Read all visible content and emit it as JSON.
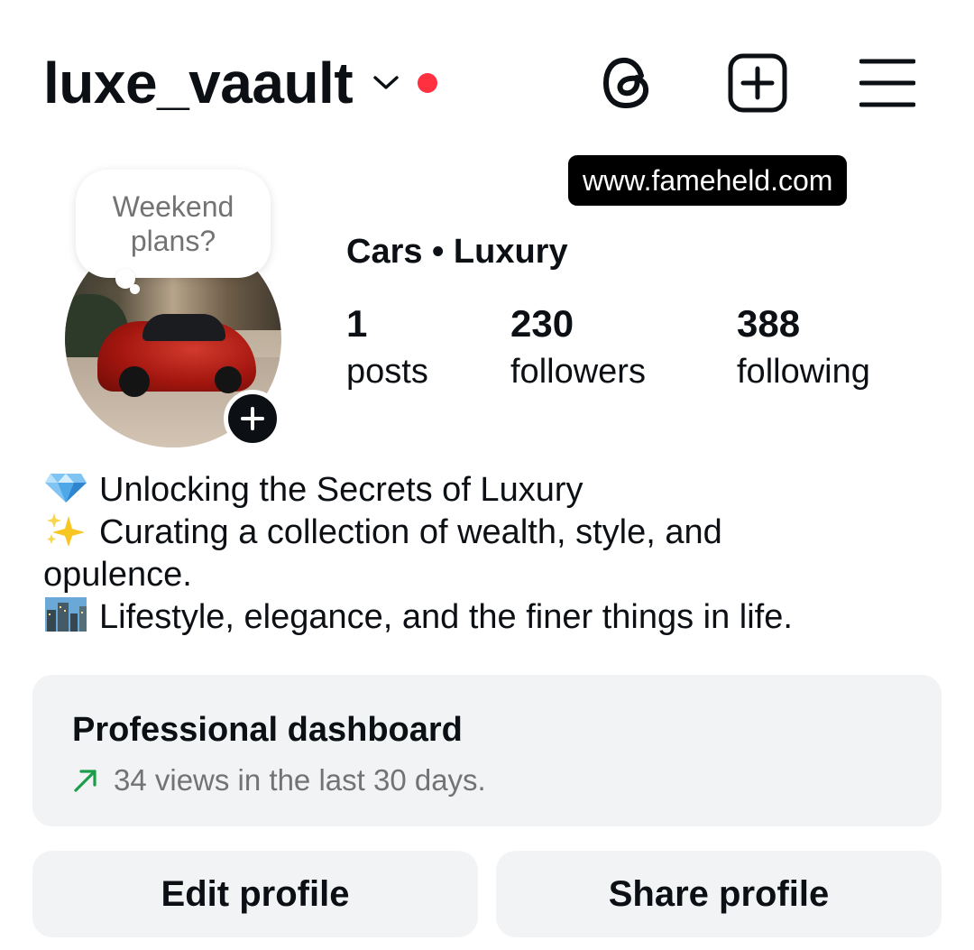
{
  "header": {
    "username": "luxe_vaault",
    "notification_dot_color": "#ff3040",
    "icons": [
      "threads-icon",
      "create-icon",
      "menu-icon"
    ]
  },
  "website": "www.fameheld.com",
  "note": {
    "text": "Weekend plans?"
  },
  "profile": {
    "category": "Cars • Luxury",
    "stats": {
      "posts": {
        "count": "1",
        "label": "posts"
      },
      "followers": {
        "count": "230",
        "label": "followers"
      },
      "following": {
        "count": "388",
        "label": "following"
      }
    }
  },
  "bio": {
    "line1": "Unlocking the Secrets of Luxury",
    "line2": "Curating a collection of wealth, style, and",
    "line3": "opulence.",
    "line4": "Lifestyle, elegance, and the finer things in life."
  },
  "dashboard": {
    "title": "Professional dashboard",
    "subtitle": "34 views in the last 30 days.",
    "trend_color": "#1a9e4a"
  },
  "actions": {
    "edit_label": "Edit profile",
    "share_label": "Share profile"
  }
}
